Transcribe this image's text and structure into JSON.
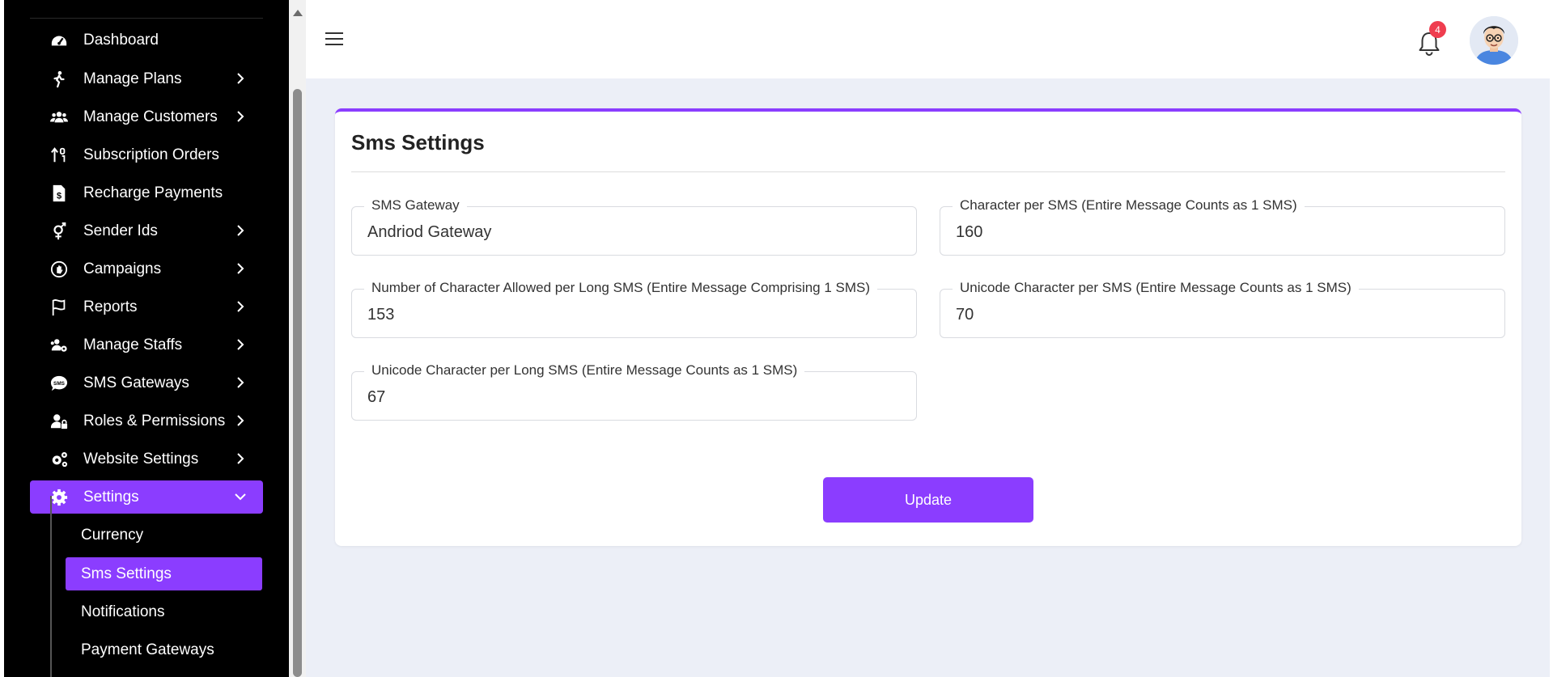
{
  "sidebar": {
    "items": [
      {
        "label": "Dashboard",
        "icon": "dashboard-gauge-icon"
      },
      {
        "label": "Manage Plans",
        "icon": "walking-person-icon"
      },
      {
        "label": "Manage Customers",
        "icon": "users-group-icon"
      },
      {
        "label": "Subscription Orders",
        "icon": "sort-numeric-icon"
      },
      {
        "label": "Recharge Payments",
        "icon": "invoice-dollar-icon"
      },
      {
        "label": "Sender Ids",
        "icon": "gender-symbol-icon"
      },
      {
        "label": "Campaigns",
        "icon": "campaign-hand-icon"
      },
      {
        "label": "Reports",
        "icon": "flag-icon"
      },
      {
        "label": "Manage Staffs",
        "icon": "staff-gear-icon"
      },
      {
        "label": "SMS Gateways",
        "icon": "sms-bubble-icon"
      },
      {
        "label": "Roles & Permissions",
        "icon": "user-lock-icon"
      },
      {
        "label": "Website Settings",
        "icon": "gears-icon"
      },
      {
        "label": "Settings",
        "icon": "gear-icon"
      }
    ],
    "submenu": [
      {
        "label": "Currency"
      },
      {
        "label": "Sms Settings"
      },
      {
        "label": "Notifications"
      },
      {
        "label": "Payment Gateways"
      }
    ]
  },
  "header": {
    "notification_count": "4"
  },
  "card": {
    "title": "Sms Settings",
    "fields": {
      "sms_gateway": {
        "label": "SMS Gateway",
        "value": "Andriod Gateway"
      },
      "char_per_sms": {
        "label": "Character per SMS (Entire Message Counts as 1 SMS)",
        "value": "160"
      },
      "char_long_sms": {
        "label": "Number of Character Allowed per Long SMS (Entire Message Comprising 1 SMS)",
        "value": "153"
      },
      "unicode_char_sms": {
        "label": "Unicode Character per SMS (Entire Message Counts as 1 SMS)",
        "value": "70"
      },
      "unicode_char_long_sms": {
        "label": "Unicode Character per Long SMS (Entire Message Counts as 1 SMS)",
        "value": "67"
      }
    },
    "update_label": "Update"
  },
  "colors": {
    "accent": "#8b3dff",
    "sidebar_bg": "#000000",
    "page_bg": "#eceff7",
    "badge": "#ef3d4f"
  }
}
